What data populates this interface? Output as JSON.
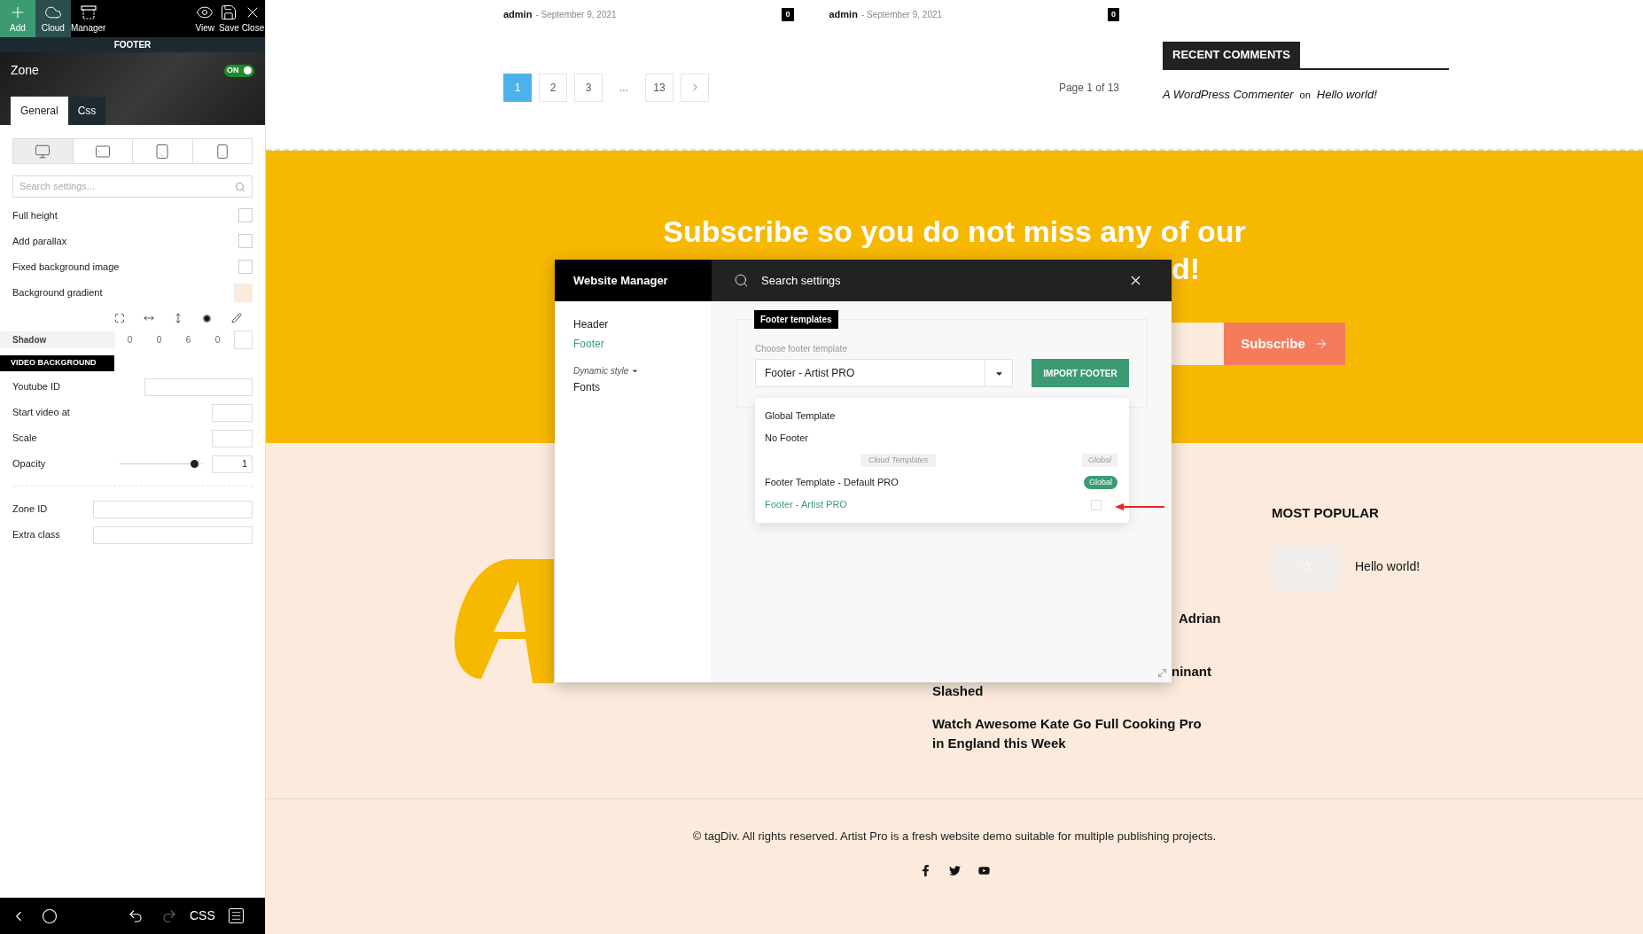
{
  "editor": {
    "toolbar": [
      {
        "kind": "add",
        "label": "Add",
        "selected": false
      },
      {
        "kind": "cloud",
        "label": "Cloud",
        "selected": true
      },
      {
        "kind": "manager",
        "label": "Manager",
        "selected": false
      },
      {
        "kind": "view",
        "label": "View",
        "selected": false
      },
      {
        "kind": "save",
        "label": "Save",
        "selected": false
      },
      {
        "kind": "close",
        "label": "Close",
        "selected": false
      }
    ],
    "section_label": "FOOTER",
    "zone": {
      "title": "Zone",
      "toggle": {
        "label": "ON",
        "on": true
      }
    },
    "tabs": [
      {
        "label": "General",
        "selected": true
      },
      {
        "label": "Css",
        "selected": false
      }
    ],
    "devices": [
      {
        "kind": "desktop",
        "selected": true
      },
      {
        "kind": "tablet-landscape",
        "selected": false
      },
      {
        "kind": "tablet",
        "selected": false
      },
      {
        "kind": "phone",
        "selected": false
      }
    ],
    "search": {
      "placeholder": "Search settings..."
    },
    "options": [
      {
        "kind": "checkbox",
        "label": "Full height",
        "checked": false
      },
      {
        "kind": "checkbox",
        "label": "Add parallax",
        "checked": false
      },
      {
        "kind": "checkbox",
        "label": "Fixed background image",
        "checked": false
      },
      {
        "kind": "color",
        "label": "Background gradient",
        "color": "#fdebdc"
      }
    ],
    "shadow": {
      "label": "Shadow",
      "values": [
        "0",
        "0",
        "6",
        "0"
      ]
    },
    "video_background": {
      "title": "VIDEO BACKGROUND",
      "fields": [
        {
          "kind": "wide",
          "label": "Youtube ID"
        },
        {
          "kind": "short",
          "label": "Start video at"
        },
        {
          "kind": "short",
          "label": "Scale"
        },
        {
          "kind": "slider",
          "label": "Opacity",
          "level": 0.95,
          "value": "1"
        }
      ]
    },
    "extra_fields": [
      {
        "label": "Zone ID"
      },
      {
        "label": "Extra class"
      }
    ],
    "bottom_bar": [
      {
        "kind": "back",
        "disabled": false
      },
      {
        "kind": "home",
        "disabled": false
      },
      {
        "kind": "undo",
        "disabled": false
      },
      {
        "kind": "redo",
        "disabled": true
      },
      {
        "kind": "css",
        "label": "CSS",
        "disabled": false
      },
      {
        "kind": "menu",
        "disabled": false
      }
    ]
  },
  "page": {
    "posts": [
      {
        "author": "admin",
        "date": "- September 9, 2021",
        "comments": "0"
      },
      {
        "author": "admin",
        "date": "- September 9, 2021",
        "comments": "0"
      }
    ],
    "pagination": [
      {
        "kind": "page",
        "label": "1",
        "selected": true
      },
      {
        "kind": "page",
        "label": "2",
        "selected": false
      },
      {
        "kind": "page",
        "label": "3",
        "selected": false
      },
      {
        "kind": "ellipsis",
        "label": "...",
        "selected": false
      },
      {
        "kind": "page",
        "label": "13",
        "selected": false
      },
      {
        "kind": "next",
        "selected": false
      }
    ],
    "page_info": "Page 1 of 13",
    "recent_comments": {
      "title": "RECENT COMMENTS",
      "author": "A WordPress Commenter",
      "on": "on",
      "post": "Hello world!"
    },
    "subscribe": {
      "title": "Subscribe so you do not miss any of our",
      "title_end": "d!",
      "button": "Subscribe"
    },
    "article_fragments": [
      "Adrian",
      "ninant"
    ],
    "articles": [
      "Slashed",
      "Watch Awesome Kate Go Full Cooking Pro in England this Week"
    ],
    "most_popular": {
      "title": "MOST POPULAR",
      "posts": [
        {
          "title": "Hello world!"
        }
      ]
    },
    "copyright": "© tagDiv. All rights reserved. Artist Pro is a fresh website demo suitable for multiple publishing projects.",
    "social": [
      {
        "kind": "facebook"
      },
      {
        "kind": "twitter"
      },
      {
        "kind": "youtube"
      }
    ]
  },
  "modal": {
    "title": "Website Manager",
    "search": {
      "placeholder": "Search settings"
    },
    "nav": [
      {
        "kind": "item",
        "label": "Header",
        "selected": false
      },
      {
        "kind": "item",
        "label": "Footer",
        "selected": true
      },
      {
        "kind": "group",
        "label": "Dynamic style",
        "selected": false
      },
      {
        "kind": "item",
        "label": "Fonts",
        "selected": false
      }
    ],
    "panel": {
      "title": "Footer templates",
      "label": "Choose footer template",
      "select": {
        "value": "Footer - Artist PRO",
        "expanded": true
      },
      "button": "IMPORT FOOTER",
      "options": [
        {
          "kind": "option",
          "label": "Global Template",
          "selected": false
        },
        {
          "kind": "option",
          "label": "No Footer",
          "selected": false
        },
        {
          "kind": "group",
          "label": "Cloud Templates",
          "tag": "Global",
          "selected": false
        },
        {
          "kind": "option",
          "label": "Footer Template - Default PRO",
          "badge": "Global",
          "selected": false
        },
        {
          "kind": "option",
          "label": "Footer - Artist PRO",
          "checked": false,
          "selected": true
        }
      ]
    }
  }
}
